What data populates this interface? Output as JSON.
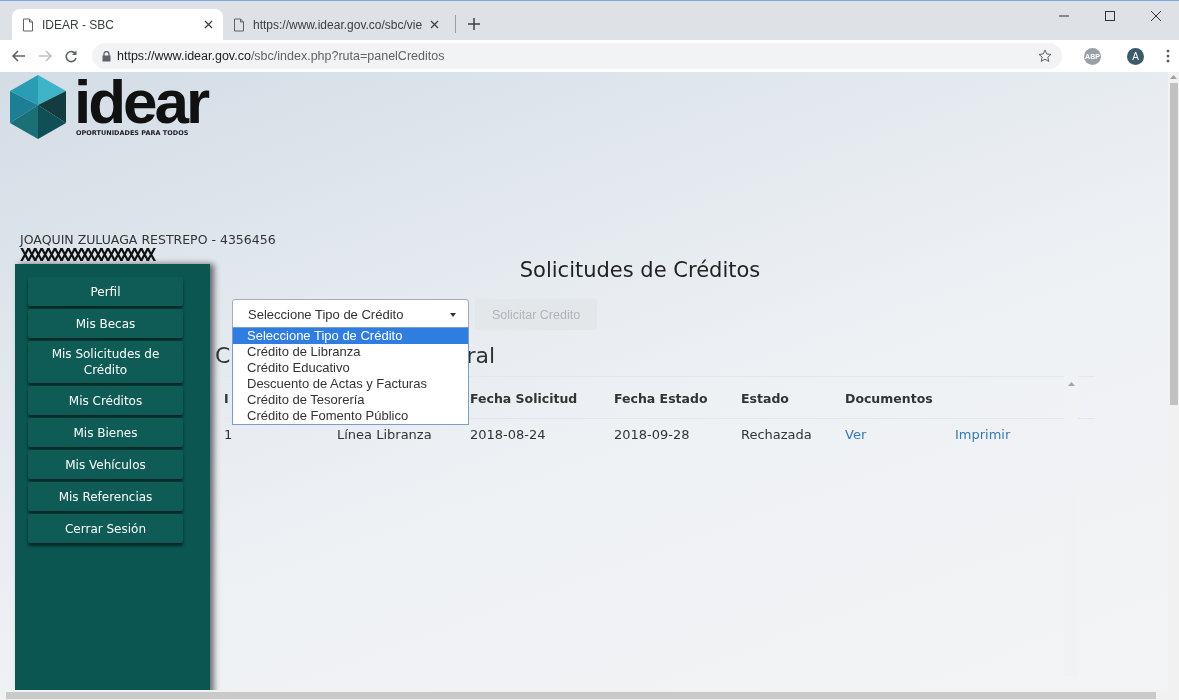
{
  "browser": {
    "tabs": [
      {
        "title": "IDEAR - SBC",
        "selected": true
      },
      {
        "title": "https://www.idear.gov.co/sbc/vie",
        "selected": false
      }
    ],
    "url_host": "https://www.idear.gov.co",
    "url_path": "/sbc/index.php?ruta=panelCreditos",
    "extension_badge": "ABP",
    "profile_initial": "A"
  },
  "logo": {
    "wordmark": "idear",
    "tagline": "OPORTUNIDADES PARA TODOS"
  },
  "user": {
    "name": "JOAQUIN ZULUAGA RESTREPO - 4356456",
    "redacted": "XXXXXXXXXXXXXXXXXXXX"
  },
  "sidebar": {
    "items": [
      {
        "label": "Perfil"
      },
      {
        "label": "Mis Becas"
      },
      {
        "label": "Mis Solicitudes de Crédito"
      },
      {
        "label": "Mis Créditos"
      },
      {
        "label": "Mis Bienes"
      },
      {
        "label": "Mis Vehículos"
      },
      {
        "label": "Mis Referencias"
      },
      {
        "label": "Cerrar Sesión"
      }
    ]
  },
  "page_title": "Solicitudes de Créditos",
  "credit_type_select": {
    "value": "Seleccione Tipo de Crédito",
    "expanded": true,
    "options": [
      {
        "label": "Seleccione Tipo de Crédito",
        "selected": true
      },
      {
        "label": "Crédito de Libranza",
        "selected": false
      },
      {
        "label": "Crédito Educativo",
        "selected": false
      },
      {
        "label": "Descuento de Actas y Facturas",
        "selected": false
      },
      {
        "label": "Crédito de Tesorería",
        "selected": false
      },
      {
        "label": "Crédito de Fomento Público",
        "selected": false
      }
    ]
  },
  "request_button": {
    "label": "Solicitar Credito",
    "disabled": true
  },
  "section_heading": {
    "visible_start": "C",
    "visible_end": "ral"
  },
  "table": {
    "columns": [
      "I",
      "",
      "Fecha Solicitud",
      "Fecha Estado",
      "Estado",
      "Documentos"
    ],
    "rows": [
      {
        "cells": [
          "1",
          "Línea Libranza",
          "2018-08-24",
          "2018-09-28",
          "Rechazada"
        ],
        "links": [
          "Ver",
          "Imprimir"
        ]
      }
    ]
  }
}
